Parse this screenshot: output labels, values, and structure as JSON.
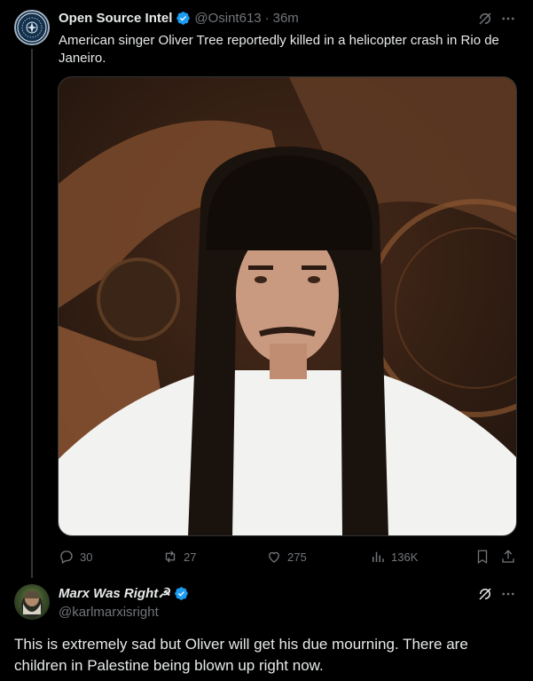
{
  "tweet": {
    "author_name": "Open Source Intel",
    "handle": "@Osint613",
    "separator": "·",
    "time": "36m",
    "text": "American singer Oliver Tree reportedly killed in a helicopter crash in Rio de Janeiro.",
    "stats": {
      "replies": "30",
      "reposts": "27",
      "likes": "275",
      "views": "136K"
    }
  },
  "reply": {
    "author_name": "Marx Was Right☭",
    "handle": "@karlmarxisright",
    "text": "This is extremely sad but Oliver will get his due mourning. There are children in Palestine being blown up right now."
  },
  "colors": {
    "background": "#000000",
    "text": "#e7e9ea",
    "muted": "#71767b",
    "verified": "#1d9bf0",
    "divider": "#333639"
  },
  "icons": [
    "verified-badge-icon",
    "grok-icon",
    "more-icon",
    "reply-icon",
    "repost-icon",
    "like-icon",
    "views-icon",
    "bookmark-icon",
    "share-icon"
  ]
}
